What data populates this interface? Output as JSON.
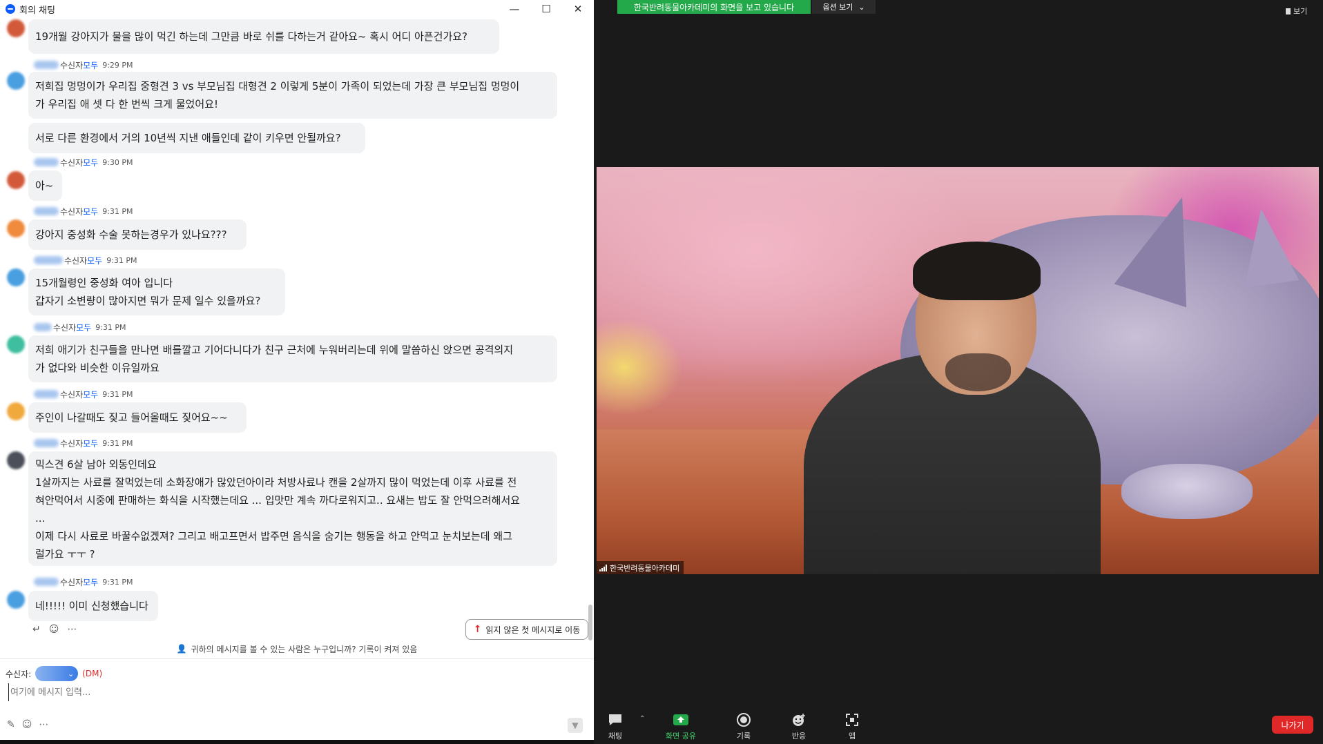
{
  "window": {
    "title": "회의 채팅"
  },
  "messages": [
    {
      "id": "m0",
      "lines": [
        "19개월 강아지가 물을 많이 먹긴 하는데 그만큼 바로 쉬를 다하는거 같아요~ 혹시 어디 아픈건가요?"
      ]
    },
    {
      "id": "m1",
      "recipient_prefix": "수신자",
      "recipient": "모두",
      "time": "9:29 PM",
      "lines": [
        "저희집 멍멍이가 우리집 중형견 3 vs 부모님집 대형견 2 이렇게 5분이 가족이 되었는데 가장 큰 부모님집 멍멍이",
        "가 우리집 애 셋 다 한 번씩 크게 물었어요!"
      ]
    },
    {
      "id": "m1b",
      "lines": [
        "서로 다른 환경에서 거의 10년씩 지낸 애들인데 같이 키우면 안될까요?"
      ]
    },
    {
      "id": "m2",
      "recipient_prefix": "수신자",
      "recipient": "모두",
      "time": "9:30 PM",
      "lines": [
        "아~"
      ]
    },
    {
      "id": "m3",
      "recipient_prefix": "수신자",
      "recipient": "모두",
      "time": "9:31 PM",
      "lines": [
        "강아지 중성화 수술 못하는경우가 있나요???"
      ]
    },
    {
      "id": "m4",
      "recipient_prefix": "수신자",
      "recipient": "모두",
      "time": "9:31 PM",
      "lines": [
        "15개월령인 중성화 여아 입니다",
        "갑자기 소변량이 많아지면 뭐가 문제 일수 있을까요?"
      ]
    },
    {
      "id": "m5",
      "recipient_prefix": "수신자",
      "recipient": "모두",
      "time": "9:31 PM",
      "lines": [
        "저희 애기가 친구들을 만나면 배를깔고 기어다니다가 친구 근처에 누워버리는데 위에 말씀하신 앉으면 공격의지",
        "가 없다와 비슷한 이유일까요"
      ]
    },
    {
      "id": "m6",
      "recipient_prefix": "수신자",
      "recipient": "모두",
      "time": "9:31 PM",
      "lines": [
        "주인이 나갈때도 짖고 들어올때도 짖어요~~"
      ]
    },
    {
      "id": "m7",
      "recipient_prefix": "수신자",
      "recipient": "모두",
      "time": "9:31 PM",
      "lines": [
        "믹스견 6살 남아 외동인데요",
        "1살까지는 사료를 잘먹었는데 소화장애가 많았던아이라 처방사료나 캔을 2살까지 많이 먹었는데 이후 사료를 전",
        "혀안먹어서 시중에 판매하는 화식을 시작했는데요 ... 입맛만 계속 까다로워지고.. 요새는 밥도 잘 안먹으려해서요",
        "...",
        "이제 다시 사료로 바꿀수없겠져? 그리고 배고프면서 밥주면 음식을 숨기는 행동을 하고 안먹고 눈치보는데 왜그",
        "럴가요 ㅜㅜ ?"
      ]
    },
    {
      "id": "m8",
      "recipient_prefix": "수신자",
      "recipient": "모두",
      "time": "9:31 PM",
      "lines": [
        "네!!!!! 이미 신청했습니다"
      ]
    }
  ],
  "jump_button": {
    "label": "읽지 않은 첫 메시지로 이동"
  },
  "privacy_notice": "귀하의 메시지를 볼 수 있는 사람은 누구입니까? 기록이 켜져 있음",
  "composer": {
    "recipient_label": "수신자:",
    "dm_tag": "(DM)",
    "placeholder": "여기에 메시지 입력..."
  },
  "meeting": {
    "share_banner": "한국반려동물아카데미의 화면을 보고 있습니다",
    "view_options": "옵션 보기",
    "view_button": "보기",
    "participant_name": "한국반려동물아카데미",
    "toolbar": {
      "chat": "채팅",
      "share": "화면 공유",
      "record": "기록",
      "reactions": "반응",
      "apps": "앱",
      "leave": "나가기"
    }
  },
  "colors": {
    "accent": "#0b5cff",
    "share_green": "#23a84a",
    "leave_red": "#e02828",
    "dm_red": "#e02828"
  }
}
